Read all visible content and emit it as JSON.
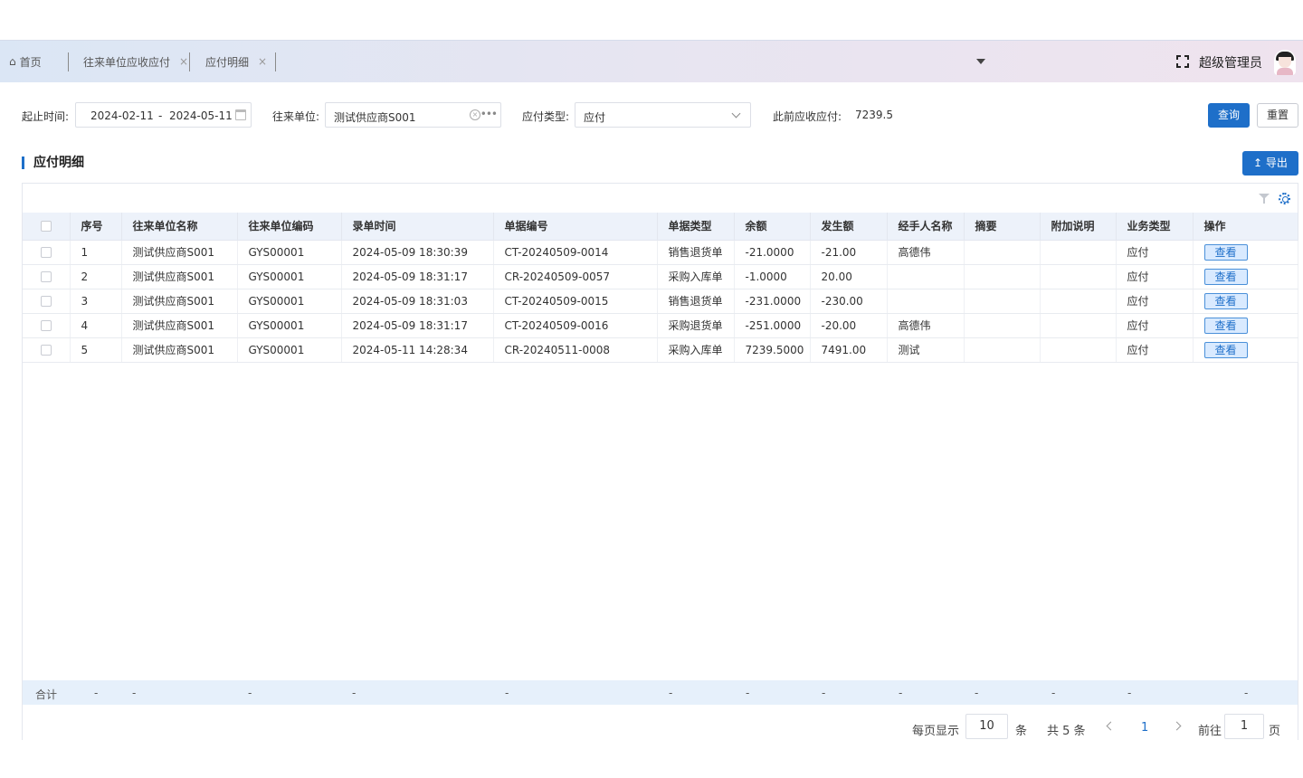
{
  "tabs": {
    "home_icon": "home-icon",
    "home": "首页",
    "tab1": "往来单位应收应付",
    "tab2": "应付明细",
    "close": "×"
  },
  "header": {
    "username": "超级管理员"
  },
  "filter": {
    "date_label": "起止时间:",
    "date_start": "2024-02-11",
    "date_sep": "-",
    "date_end": "2024-05-11",
    "unit_label": "往来单位:",
    "unit_value": "测试供应商S001",
    "type_label": "应付类型:",
    "type_value": "应付",
    "prev_label": "此前应收应付:",
    "prev_value": "7239.5",
    "query_btn": "查询",
    "reset_btn": "重置"
  },
  "section": {
    "title": "应付明细",
    "export_btn": "导出",
    "export_icon": "upload-icon"
  },
  "table": {
    "columns": [
      "序号",
      "往来单位名称",
      "往来单位编码",
      "录单时间",
      "单据编号",
      "单据类型",
      "余额",
      "发生额",
      "经手人名称",
      "摘要",
      "附加说明",
      "业务类型",
      "操作"
    ],
    "rows": [
      {
        "no": "1",
        "name": "测试供应商S001",
        "code": "GYS00001",
        "time": "2024-05-09 18:30:39",
        "doc": "CT-20240509-0014",
        "doc_type": "销售退货单",
        "balance": "-21.0000",
        "amount": "-21.00",
        "handler": "高德伟",
        "summary": "",
        "note": "",
        "biz": "应付",
        "action": "查看"
      },
      {
        "no": "2",
        "name": "测试供应商S001",
        "code": "GYS00001",
        "time": "2024-05-09 18:31:17",
        "doc": "CR-20240509-0057",
        "doc_type": "采购入库单",
        "balance": "-1.0000",
        "amount": "20.00",
        "handler": "",
        "summary": "",
        "note": "",
        "biz": "应付",
        "action": "查看"
      },
      {
        "no": "3",
        "name": "测试供应商S001",
        "code": "GYS00001",
        "time": "2024-05-09 18:31:03",
        "doc": "CT-20240509-0015",
        "doc_type": "销售退货单",
        "balance": "-231.0000",
        "amount": "-230.00",
        "handler": "",
        "summary": "",
        "note": "",
        "biz": "应付",
        "action": "查看"
      },
      {
        "no": "4",
        "name": "测试供应商S001",
        "code": "GYS00001",
        "time": "2024-05-09 18:31:17",
        "doc": "CT-20240509-0016",
        "doc_type": "采购退货单",
        "balance": "-251.0000",
        "amount": "-20.00",
        "handler": "高德伟",
        "summary": "",
        "note": "",
        "biz": "应付",
        "action": "查看"
      },
      {
        "no": "5",
        "name": "测试供应商S001",
        "code": "GYS00001",
        "time": "2024-05-11 14:28:34",
        "doc": "CR-20240511-0008",
        "doc_type": "采购入库单",
        "balance": "7239.5000",
        "amount": "7491.00",
        "handler": "测试",
        "summary": "",
        "note": "",
        "biz": "应付",
        "action": "查看"
      }
    ],
    "sum_label": "合计",
    "dash": "-"
  },
  "pager": {
    "per_page_label": "每页显示",
    "per_page": "10",
    "unit": "条",
    "total": "共 5 条",
    "current": "1",
    "goto_label": "前往",
    "goto_page": "1",
    "page_unit": "页"
  }
}
